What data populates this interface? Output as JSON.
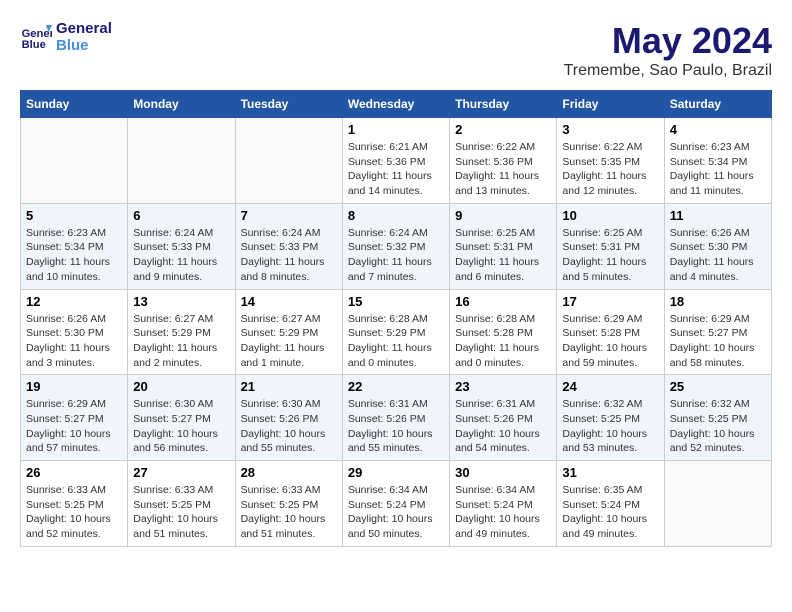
{
  "header": {
    "logo_line1": "General",
    "logo_line2": "Blue",
    "month_title": "May 2024",
    "subtitle": "Tremembe, Sao Paulo, Brazil"
  },
  "days_of_week": [
    "Sunday",
    "Monday",
    "Tuesday",
    "Wednesday",
    "Thursday",
    "Friday",
    "Saturday"
  ],
  "weeks": [
    [
      {
        "day": "",
        "info": ""
      },
      {
        "day": "",
        "info": ""
      },
      {
        "day": "",
        "info": ""
      },
      {
        "day": "1",
        "info": "Sunrise: 6:21 AM\nSunset: 5:36 PM\nDaylight: 11 hours and 14 minutes."
      },
      {
        "day": "2",
        "info": "Sunrise: 6:22 AM\nSunset: 5:36 PM\nDaylight: 11 hours and 13 minutes."
      },
      {
        "day": "3",
        "info": "Sunrise: 6:22 AM\nSunset: 5:35 PM\nDaylight: 11 hours and 12 minutes."
      },
      {
        "day": "4",
        "info": "Sunrise: 6:23 AM\nSunset: 5:34 PM\nDaylight: 11 hours and 11 minutes."
      }
    ],
    [
      {
        "day": "5",
        "info": "Sunrise: 6:23 AM\nSunset: 5:34 PM\nDaylight: 11 hours and 10 minutes."
      },
      {
        "day": "6",
        "info": "Sunrise: 6:24 AM\nSunset: 5:33 PM\nDaylight: 11 hours and 9 minutes."
      },
      {
        "day": "7",
        "info": "Sunrise: 6:24 AM\nSunset: 5:33 PM\nDaylight: 11 hours and 8 minutes."
      },
      {
        "day": "8",
        "info": "Sunrise: 6:24 AM\nSunset: 5:32 PM\nDaylight: 11 hours and 7 minutes."
      },
      {
        "day": "9",
        "info": "Sunrise: 6:25 AM\nSunset: 5:31 PM\nDaylight: 11 hours and 6 minutes."
      },
      {
        "day": "10",
        "info": "Sunrise: 6:25 AM\nSunset: 5:31 PM\nDaylight: 11 hours and 5 minutes."
      },
      {
        "day": "11",
        "info": "Sunrise: 6:26 AM\nSunset: 5:30 PM\nDaylight: 11 hours and 4 minutes."
      }
    ],
    [
      {
        "day": "12",
        "info": "Sunrise: 6:26 AM\nSunset: 5:30 PM\nDaylight: 11 hours and 3 minutes."
      },
      {
        "day": "13",
        "info": "Sunrise: 6:27 AM\nSunset: 5:29 PM\nDaylight: 11 hours and 2 minutes."
      },
      {
        "day": "14",
        "info": "Sunrise: 6:27 AM\nSunset: 5:29 PM\nDaylight: 11 hours and 1 minute."
      },
      {
        "day": "15",
        "info": "Sunrise: 6:28 AM\nSunset: 5:29 PM\nDaylight: 11 hours and 0 minutes."
      },
      {
        "day": "16",
        "info": "Sunrise: 6:28 AM\nSunset: 5:28 PM\nDaylight: 11 hours and 0 minutes."
      },
      {
        "day": "17",
        "info": "Sunrise: 6:29 AM\nSunset: 5:28 PM\nDaylight: 10 hours and 59 minutes."
      },
      {
        "day": "18",
        "info": "Sunrise: 6:29 AM\nSunset: 5:27 PM\nDaylight: 10 hours and 58 minutes."
      }
    ],
    [
      {
        "day": "19",
        "info": "Sunrise: 6:29 AM\nSunset: 5:27 PM\nDaylight: 10 hours and 57 minutes."
      },
      {
        "day": "20",
        "info": "Sunrise: 6:30 AM\nSunset: 5:27 PM\nDaylight: 10 hours and 56 minutes."
      },
      {
        "day": "21",
        "info": "Sunrise: 6:30 AM\nSunset: 5:26 PM\nDaylight: 10 hours and 55 minutes."
      },
      {
        "day": "22",
        "info": "Sunrise: 6:31 AM\nSunset: 5:26 PM\nDaylight: 10 hours and 55 minutes."
      },
      {
        "day": "23",
        "info": "Sunrise: 6:31 AM\nSunset: 5:26 PM\nDaylight: 10 hours and 54 minutes."
      },
      {
        "day": "24",
        "info": "Sunrise: 6:32 AM\nSunset: 5:25 PM\nDaylight: 10 hours and 53 minutes."
      },
      {
        "day": "25",
        "info": "Sunrise: 6:32 AM\nSunset: 5:25 PM\nDaylight: 10 hours and 52 minutes."
      }
    ],
    [
      {
        "day": "26",
        "info": "Sunrise: 6:33 AM\nSunset: 5:25 PM\nDaylight: 10 hours and 52 minutes."
      },
      {
        "day": "27",
        "info": "Sunrise: 6:33 AM\nSunset: 5:25 PM\nDaylight: 10 hours and 51 minutes."
      },
      {
        "day": "28",
        "info": "Sunrise: 6:33 AM\nSunset: 5:25 PM\nDaylight: 10 hours and 51 minutes."
      },
      {
        "day": "29",
        "info": "Sunrise: 6:34 AM\nSunset: 5:24 PM\nDaylight: 10 hours and 50 minutes."
      },
      {
        "day": "30",
        "info": "Sunrise: 6:34 AM\nSunset: 5:24 PM\nDaylight: 10 hours and 49 minutes."
      },
      {
        "day": "31",
        "info": "Sunrise: 6:35 AM\nSunset: 5:24 PM\nDaylight: 10 hours and 49 minutes."
      },
      {
        "day": "",
        "info": ""
      }
    ]
  ]
}
